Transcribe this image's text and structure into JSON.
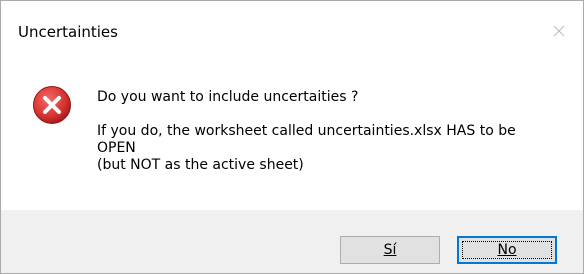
{
  "dialog": {
    "title": "Uncertainties",
    "icon": "error-icon",
    "message": {
      "line1": "Do you want to include uncertaities ?",
      "line2": "If you do, the worksheet called uncertainties.xlsx HAS to be",
      "line3": "OPEN",
      "line4": "(but NOT as the active sheet)"
    },
    "buttons": {
      "yes_label": "Sí",
      "no_label": "No"
    }
  },
  "colors": {
    "accent": "#0078d7",
    "error_red": "#d9322f",
    "footer_bg": "#f0f0f0",
    "button_bg": "#e1e1e1"
  }
}
